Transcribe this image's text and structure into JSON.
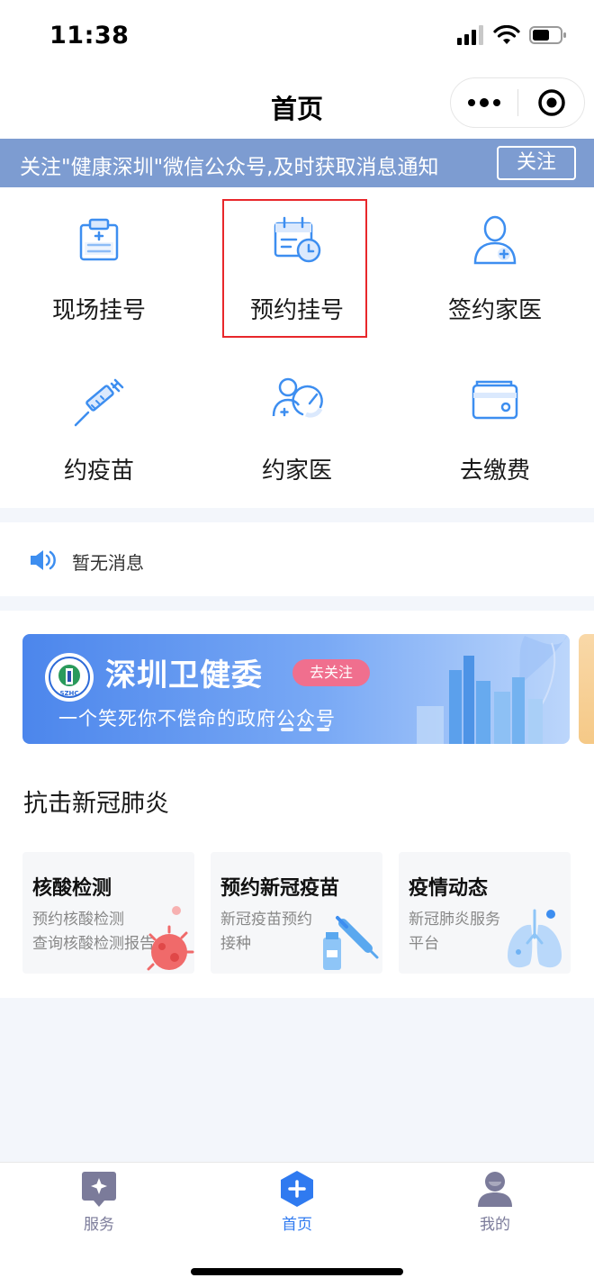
{
  "status_bar": {
    "time": "11:38"
  },
  "nav": {
    "title": "首页"
  },
  "notice": {
    "text": "关注\"健康深圳\"微信公众号,及时获取消息通知",
    "button": "关注"
  },
  "services": [
    {
      "label": "现场挂号",
      "icon": "clipboard-cross-icon"
    },
    {
      "label": "预约挂号",
      "icon": "calendar-clock-icon"
    },
    {
      "label": "签约家医",
      "icon": "doctor-plus-icon"
    },
    {
      "label": "约疫苗",
      "icon": "syringe-icon"
    },
    {
      "label": "约家医",
      "icon": "doctor-gauge-icon"
    },
    {
      "label": "去缴费",
      "icon": "wallet-icon"
    }
  ],
  "message": {
    "text": "暂无消息"
  },
  "banner": {
    "title": "深圳卫健委",
    "badge": "去关注",
    "subtitle": "一个笑死你不偿命的政府公众号",
    "logo_text": "SZHC"
  },
  "section": {
    "title": "抗击新冠肺炎"
  },
  "cards": [
    {
      "title": "核酸检测",
      "line1": "预约核酸检测",
      "line2": "查询核酸检测报告"
    },
    {
      "title": "预约新冠疫苗",
      "line1": "新冠疫苗预约",
      "line2": "接种"
    },
    {
      "title": "疫情动态",
      "line1": "新冠肺炎服务",
      "line2": "平台"
    }
  ],
  "tabbar": [
    {
      "label": "服务"
    },
    {
      "label": "首页"
    },
    {
      "label": "我的"
    }
  ],
  "colors": {
    "accent": "#2f7af0",
    "notice_bg": "#7d9cd1",
    "highlight": "#e8272b",
    "icon_blue": "#3d8ef0"
  }
}
